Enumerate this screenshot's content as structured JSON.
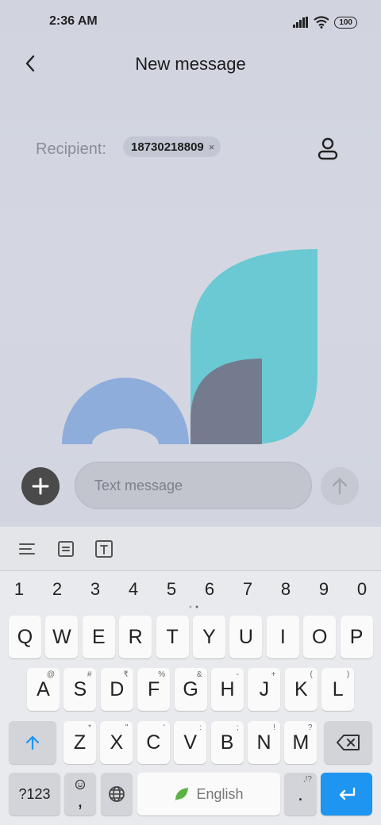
{
  "status": {
    "time": "2:36 AM",
    "battery": "100"
  },
  "header": {
    "title": "New message"
  },
  "recipient": {
    "label": "Recipient:",
    "number": "18730218809",
    "remove": "×"
  },
  "compose": {
    "placeholder": "Text message"
  },
  "keyboard": {
    "numbers": [
      "1",
      "2",
      "3",
      "4",
      "5",
      "6",
      "7",
      "8",
      "9",
      "0"
    ],
    "row1": [
      "Q",
      "W",
      "E",
      "R",
      "T",
      "Y",
      "U",
      "I",
      "O",
      "P"
    ],
    "row2": [
      {
        "key": "A",
        "hint": "@"
      },
      {
        "key": "S",
        "hint": "#"
      },
      {
        "key": "D",
        "hint": "₹"
      },
      {
        "key": "F",
        "hint": "%"
      },
      {
        "key": "G",
        "hint": "&"
      },
      {
        "key": "H",
        "hint": "-"
      },
      {
        "key": "J",
        "hint": "+"
      },
      {
        "key": "K",
        "hint": "("
      },
      {
        "key": "L",
        "hint": ")"
      }
    ],
    "row3": [
      {
        "key": "Z",
        "hint": "*"
      },
      {
        "key": "X",
        "hint": "\""
      },
      {
        "key": "C",
        "hint": "'"
      },
      {
        "key": "V",
        "hint": ":"
      },
      {
        "key": "B",
        "hint": ";"
      },
      {
        "key": "N",
        "hint": "!"
      },
      {
        "key": "M",
        "hint": "?"
      }
    ],
    "symbols_label": "?123",
    "comma": ",",
    "space_label": "English",
    "period": ".",
    "period_hint": ",!?"
  },
  "colors": {
    "accent": "#1e95f0",
    "teal": "#6ac9d2",
    "blue": "#8faddb",
    "slate": "#747b8e"
  }
}
